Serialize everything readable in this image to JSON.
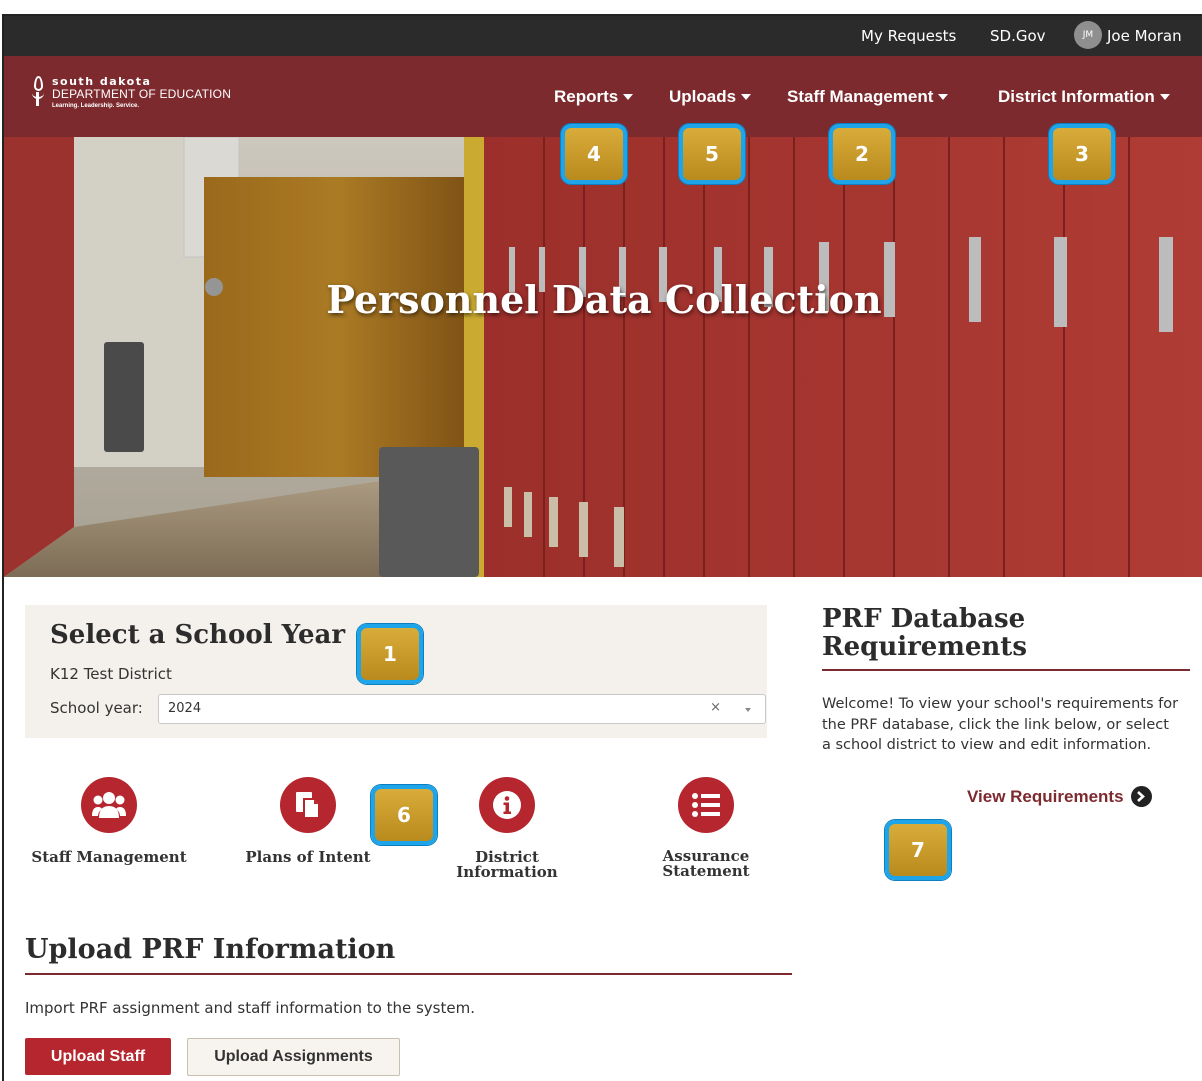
{
  "util_bar": {
    "my_requests": "My Requests",
    "sd_gov": "SD.Gov",
    "avatar_initials": "JM",
    "user_name": "Joe Moran"
  },
  "logo": {
    "line1": "south dakota",
    "line2": "DEPARTMENT OF EDUCATION",
    "tagline": "Learning. Leadership. Service."
  },
  "nav": {
    "reports": "Reports",
    "uploads": "Uploads",
    "staff_management": "Staff Management",
    "district_information": "District Information"
  },
  "hero": {
    "title": "Personnel Data Collection"
  },
  "callouts": [
    "1",
    "2",
    "3",
    "4",
    "5",
    "6",
    "7"
  ],
  "school_year": {
    "title": "Select a School Year",
    "district": "K12 Test District",
    "label": "School year:",
    "value": "2024",
    "clear": "×"
  },
  "quick_links": {
    "staff_management": "Staff Management",
    "plans_of_intent": "Plans of Intent",
    "district_information": "District Information",
    "assurance_line1": "Assurance",
    "assurance_line2": "Statement"
  },
  "upload": {
    "title": "Upload PRF Information",
    "description": "Import PRF assignment and staff information to the system.",
    "upload_staff": "Upload Staff",
    "upload_assignments": "Upload Assignments"
  },
  "prf": {
    "title_line1": "PRF Database",
    "title_line2": "Requirements",
    "description": "Welcome! To view your school's requirements for the PRF database, click the link below, or select a school district to view and edit information.",
    "view_requirements": "View Requirements"
  },
  "colors": {
    "brand_maroon": "#7d2a2f",
    "accent_red": "#b5262e",
    "util_bar": "#2b2b2b",
    "callout_gold": "#c99b27",
    "callout_border": "#1ea4e8"
  }
}
